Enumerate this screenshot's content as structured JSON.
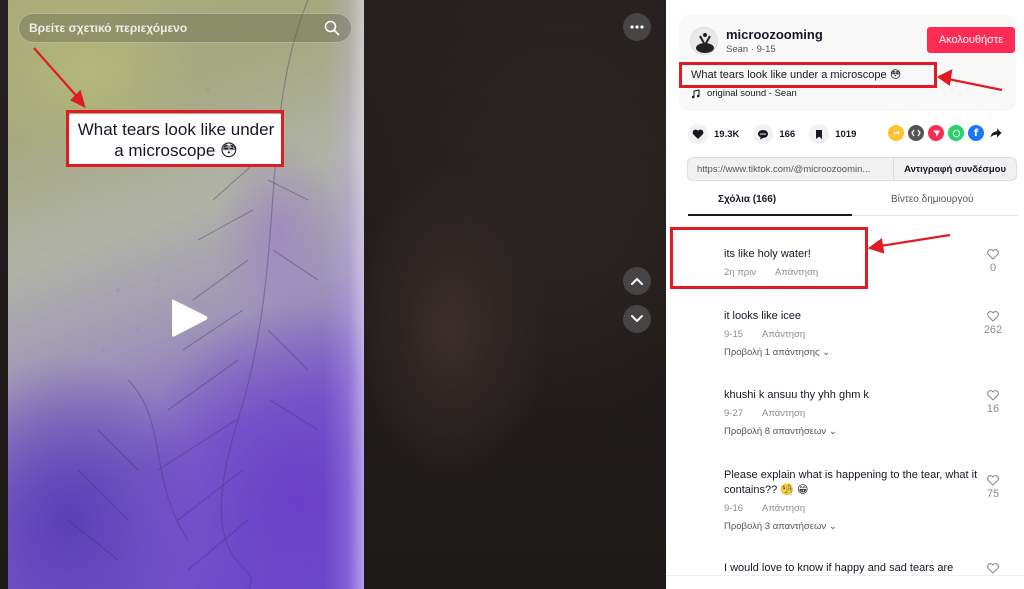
{
  "video": {
    "search_placeholder": "Βρείτε σχετικό περιεχόμενο",
    "overlay_caption_line1": "What tears look like under",
    "overlay_caption_line2": "a microscope 😳"
  },
  "author": {
    "username": "microozooming",
    "display_name": "Sean",
    "date": "9-15",
    "follow_label": "Ακολουθήστε"
  },
  "post": {
    "description": "What tears look like under a microscope 😳",
    "sound": "original sound - Sean"
  },
  "stats": {
    "likes": "19.3K",
    "comments": "166",
    "saves": "1019"
  },
  "share_icons": [
    "repost-icon",
    "embed-icon",
    "send-icon",
    "whatsapp-icon",
    "facebook-icon",
    "share-arrow-icon"
  ],
  "link": {
    "url": "https://www.tiktok.com/@microozoomin...",
    "copy_label": "Αντιγραφή συνδέσμου"
  },
  "tabs": {
    "comments": "Σχόλια (166)",
    "creator_videos": "Βίντεο δημιουργού"
  },
  "comments": [
    {
      "text": "its like holy water!",
      "time": "2η πριν",
      "reply": "Απάντηση",
      "likes": "0",
      "more": ""
    },
    {
      "text": "it looks like icee",
      "time": "9-15",
      "reply": "Απάντηση",
      "likes": "262",
      "more": "Προβολή 1 απάντησης"
    },
    {
      "text": "khushi k ansuu thy yhh ghm k",
      "time": "9-27",
      "reply": "Απάντηση",
      "likes": "16",
      "more": "Προβολή 8 απαντήσεων"
    },
    {
      "text": "Please explain what is happening to the tear, what it contains?? 🧐 😁",
      "time": "9-16",
      "reply": "Απάντηση",
      "likes": "75",
      "more": "Προβολή 3 απαντήσεων"
    },
    {
      "text": "I would love to know if happy and sad tears are",
      "time": "",
      "reply": "",
      "likes": "",
      "more": ""
    }
  ],
  "colors": {
    "accent": "#fe2c55",
    "annotation": "#e01b24"
  }
}
